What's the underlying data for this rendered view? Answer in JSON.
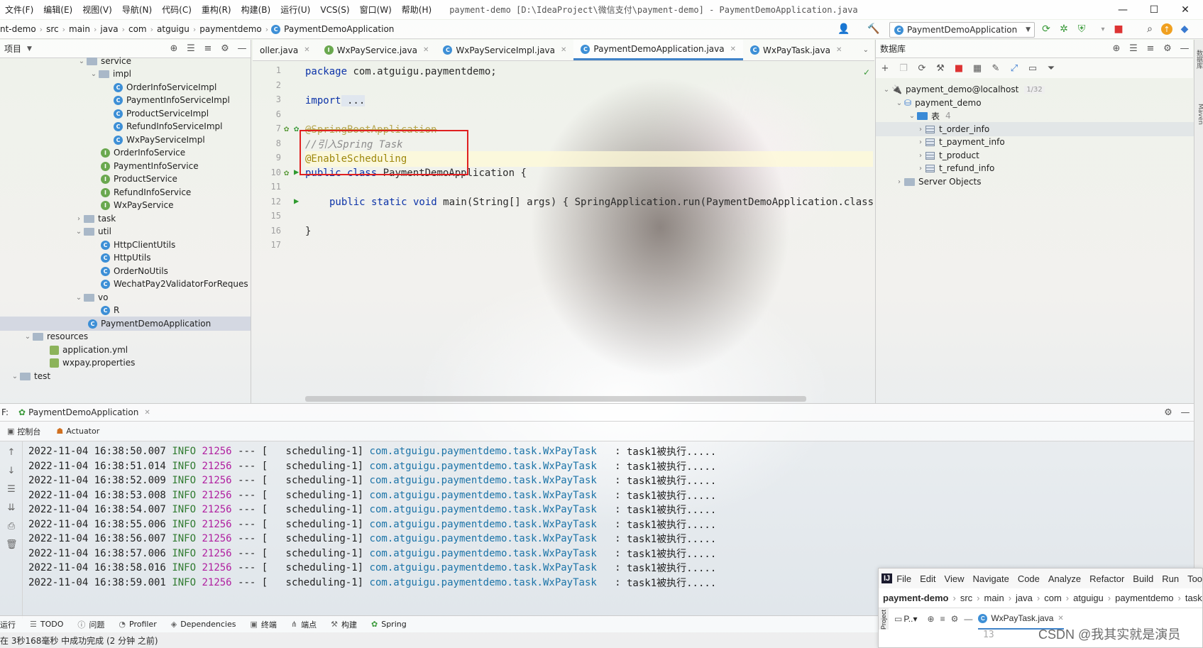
{
  "menubar": {
    "items": [
      "文件(F)",
      "编辑(E)",
      "视图(V)",
      "导航(N)",
      "代码(C)",
      "重构(R)",
      "构建(B)",
      "运行(U)",
      "VCS(S)",
      "窗口(W)",
      "帮助(H)"
    ],
    "title": "payment-demo [D:\\IdeaProject\\微信支付\\payment-demo] - PaymentDemoApplication.java"
  },
  "breadcrumb": [
    "nt-demo",
    "src",
    "main",
    "java",
    "com",
    "atguigu",
    "paymentdemo",
    "PaymentDemoApplication"
  ],
  "run_config": {
    "label": "PaymentDemoApplication"
  },
  "project": {
    "title": "项目",
    "items": [
      {
        "label": "service",
        "indent": 6
      },
      {
        "label": "impl",
        "indent": 7
      },
      {
        "label": "OrderInfoServiceImpl",
        "indent": 9
      },
      {
        "label": "PaymentInfoServiceImpl",
        "indent": 9
      },
      {
        "label": "ProductServiceImpl",
        "indent": 9
      },
      {
        "label": "RefundInfoServiceImpl",
        "indent": 9
      },
      {
        "label": "WxPayServiceImpl",
        "indent": 9
      },
      {
        "label": "OrderInfoService",
        "indent": 8
      },
      {
        "label": "PaymentInfoService",
        "indent": 8
      },
      {
        "label": "ProductService",
        "indent": 8
      },
      {
        "label": "RefundInfoService",
        "indent": 8
      },
      {
        "label": "WxPayService",
        "indent": 8
      },
      {
        "label": "task",
        "indent": 6
      },
      {
        "label": "util",
        "indent": 6
      },
      {
        "label": "HttpClientUtils",
        "indent": 8
      },
      {
        "label": "HttpUtils",
        "indent": 8
      },
      {
        "label": "OrderNoUtils",
        "indent": 8
      },
      {
        "label": "WechatPay2ValidatorForReques",
        "indent": 8
      },
      {
        "label": "vo",
        "indent": 6
      },
      {
        "label": "R",
        "indent": 8
      },
      {
        "label": "PaymentDemoApplication",
        "indent": 7
      },
      {
        "label": "resources",
        "indent": 2
      },
      {
        "label": "application.yml",
        "indent": 4
      },
      {
        "label": "wxpay.properties",
        "indent": 4
      },
      {
        "label": "test",
        "indent": 1
      }
    ]
  },
  "editor": {
    "tabs": [
      {
        "label": "oller.java",
        "active": false
      },
      {
        "label": "WxPayService.java",
        "active": false
      },
      {
        "label": "WxPayServiceImpl.java",
        "active": false
      },
      {
        "label": "PaymentDemoApplication.java",
        "active": true
      },
      {
        "label": "WxPayTask.java",
        "active": false
      }
    ],
    "line_numbers": [
      "1",
      "2",
      "3",
      "6",
      "7",
      "8",
      "9",
      "10",
      "11",
      "12",
      "15",
      "16",
      "17"
    ],
    "code": {
      "l1_kw": "package",
      "l1_rest": " com.atguigu.paymentdemo;",
      "l3_kw": "import",
      "l3_rest": " ...",
      "l7": "@SpringBootApplication",
      "l8": "//引入Spring Task",
      "l9": "@EnableScheduling",
      "l10_kw": "public class",
      "l10_rest": " PaymentDemoApplication {",
      "l12_kw": "public static void",
      "l12_rest": " main(String[] args) { SpringApplication.run(PaymentDemoApplication.class, arg",
      "l16": "}"
    }
  },
  "database": {
    "title": "数据库",
    "connection": "payment_demo@localhost",
    "connection_badge": "1/32",
    "schema": "payment_demo",
    "tables_folder": "表",
    "tables_count": "4",
    "tables": [
      "t_order_info",
      "t_payment_info",
      "t_product",
      "t_refund_info"
    ],
    "server_objects": "Server Objects"
  },
  "run_panel": {
    "prefix": "F:",
    "tab_label": "PaymentDemoApplication",
    "sub_tabs": [
      "控制台",
      "Actuator"
    ],
    "log": {
      "level": "INFO",
      "pid": "21256",
      "sep": "---",
      "thread": "scheduling-1]",
      "logger": "com.atguigu.paymentdemo.task.WxPayTask",
      "message": "task1被执行.....",
      "timestamps": [
        "2022-11-04 16:38:50.007",
        "2022-11-04 16:38:51.014",
        "2022-11-04 16:38:52.009",
        "2022-11-04 16:38:53.008",
        "2022-11-04 16:38:54.007",
        "2022-11-04 16:38:55.006",
        "2022-11-04 16:38:56.007",
        "2022-11-04 16:38:57.006",
        "2022-11-04 16:38:58.016",
        "2022-11-04 16:38:59.001"
      ]
    }
  },
  "tool_windows": [
    "运行",
    "TODO",
    "问题",
    "Profiler",
    "Dependencies",
    "终端",
    "端点",
    "构建",
    "Spring"
  ],
  "status": "在 3秒168毫秒 中成功完成 (2 分钟 之前)",
  "overlay": {
    "menu": [
      "File",
      "Edit",
      "View",
      "Navigate",
      "Code",
      "Analyze",
      "Refactor",
      "Build",
      "Run",
      "Tool"
    ],
    "breadcrumb": [
      "payment-demo",
      "src",
      "main",
      "java",
      "com",
      "atguigu",
      "paymentdemo",
      "task"
    ],
    "tab_left": "P..▾",
    "tab_file": "WxPayTask.java",
    "line": "13",
    "side_label": "Project"
  },
  "watermark": "CSDN @我其实就是演员",
  "strip_labels": [
    "数据库",
    "Maven"
  ],
  "colors": {
    "accent": "#4083c9",
    "highlight_box": "#e02020",
    "annotation": "#9e880d",
    "keyword": "#0c33a8"
  }
}
